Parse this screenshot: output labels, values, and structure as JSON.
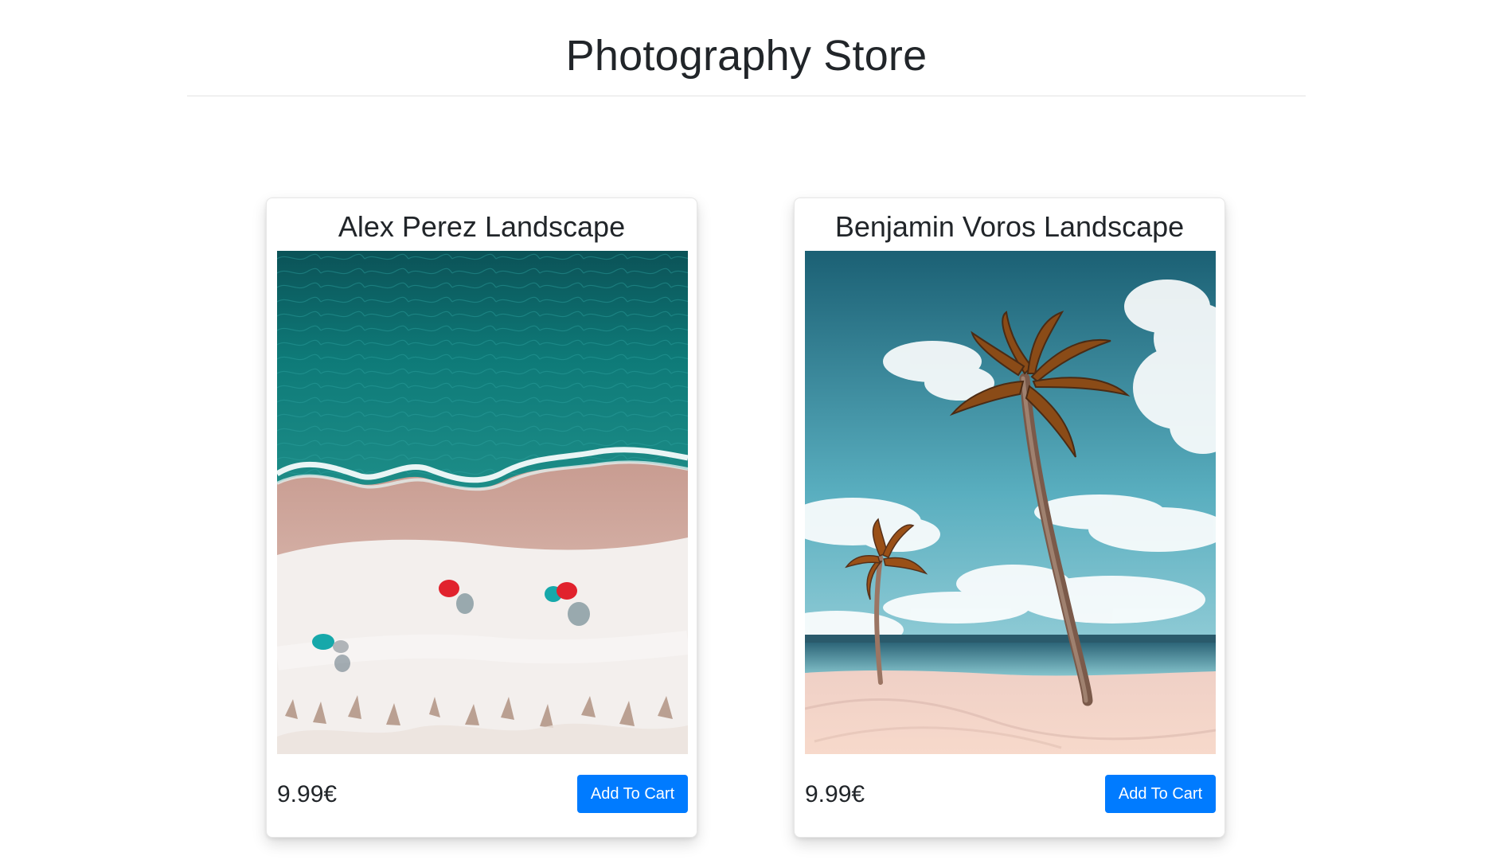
{
  "page": {
    "title": "Photography Store"
  },
  "products": [
    {
      "title": "Alex Perez Landscape",
      "price": "9.99€",
      "button_label": "Add To Cart",
      "image_subject": "aerial beach with umbrellas"
    },
    {
      "title": "Benjamin Voros Landscape",
      "price": "9.99€",
      "button_label": "Add To Cart",
      "image_subject": "palm trees on beach"
    }
  ],
  "colors": {
    "button_primary": "#007bff",
    "button_text": "#ffffff",
    "heading_text": "#212529"
  }
}
